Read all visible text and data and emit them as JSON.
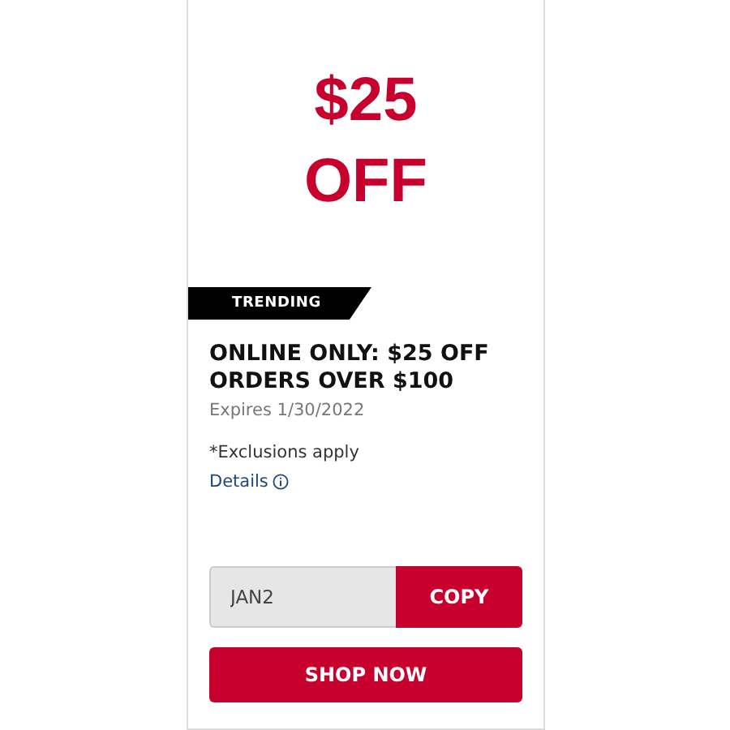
{
  "offer": {
    "amount": "$25",
    "unit": "OFF"
  },
  "badge": {
    "label": "TRENDING"
  },
  "title": "ONLINE ONLY: $25 OFF ORDERS OVER $100",
  "expires": "Expires 1/30/2022",
  "note": "*Exclusions apply",
  "details_link": "Details",
  "code": {
    "value": "JAN2",
    "button": "COPY"
  },
  "shop_button": "SHOP NOW"
}
